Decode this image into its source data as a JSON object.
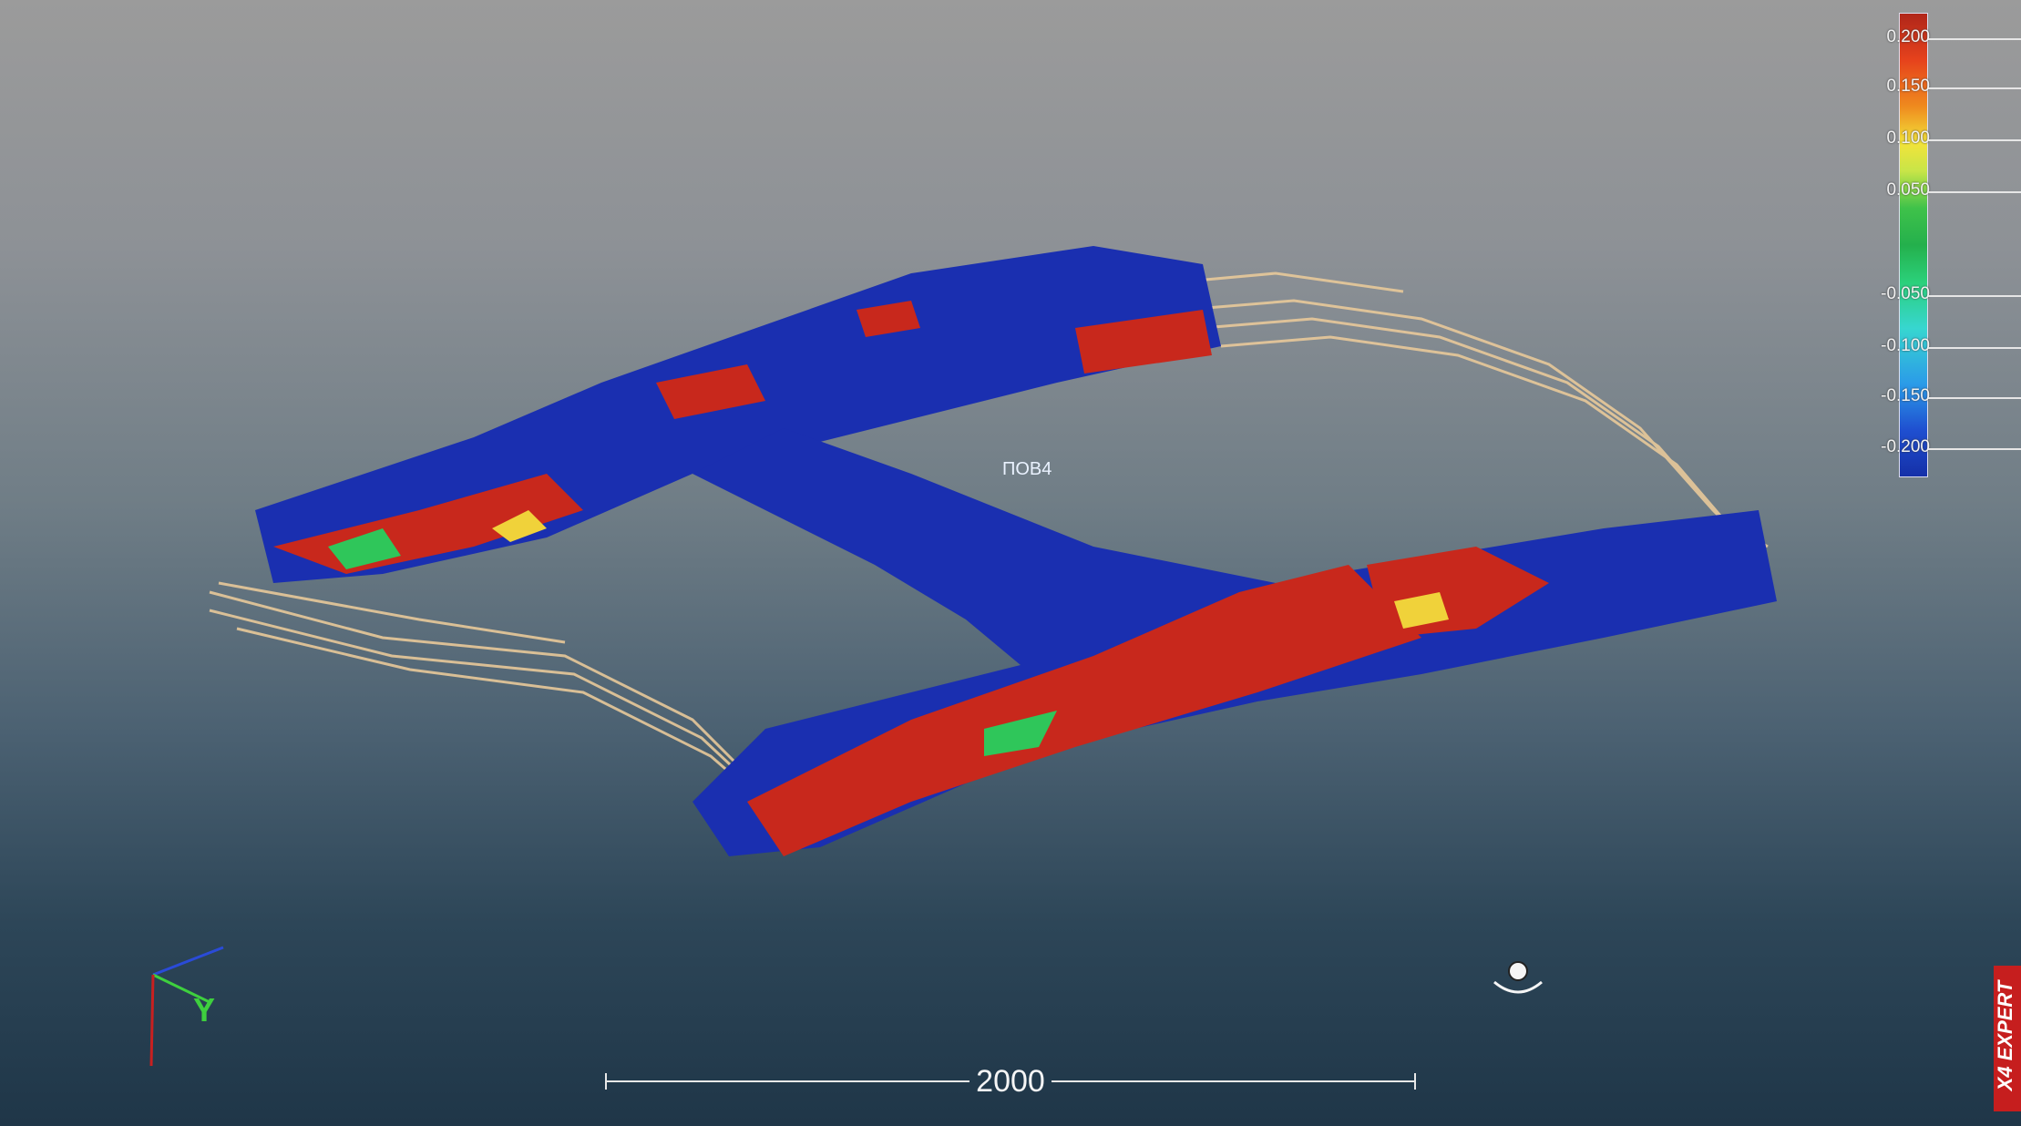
{
  "viewport": {
    "part_label": "ПОВ4",
    "axis_label": "Y",
    "scale_bar": {
      "label": "2000"
    }
  },
  "legend": {
    "ticks": [
      "0.200",
      "0.150",
      "0.100",
      "0.050",
      "-0.050",
      "-0.100",
      "-0.150",
      "-0.200"
    ]
  },
  "brand": {
    "text": "X4 EXPERT"
  },
  "colors": {
    "deviation_high": "#c8281c",
    "deviation_low": "#1a2fb0",
    "nominal": "#2fc65a",
    "wireframe": "#e8c99a"
  }
}
